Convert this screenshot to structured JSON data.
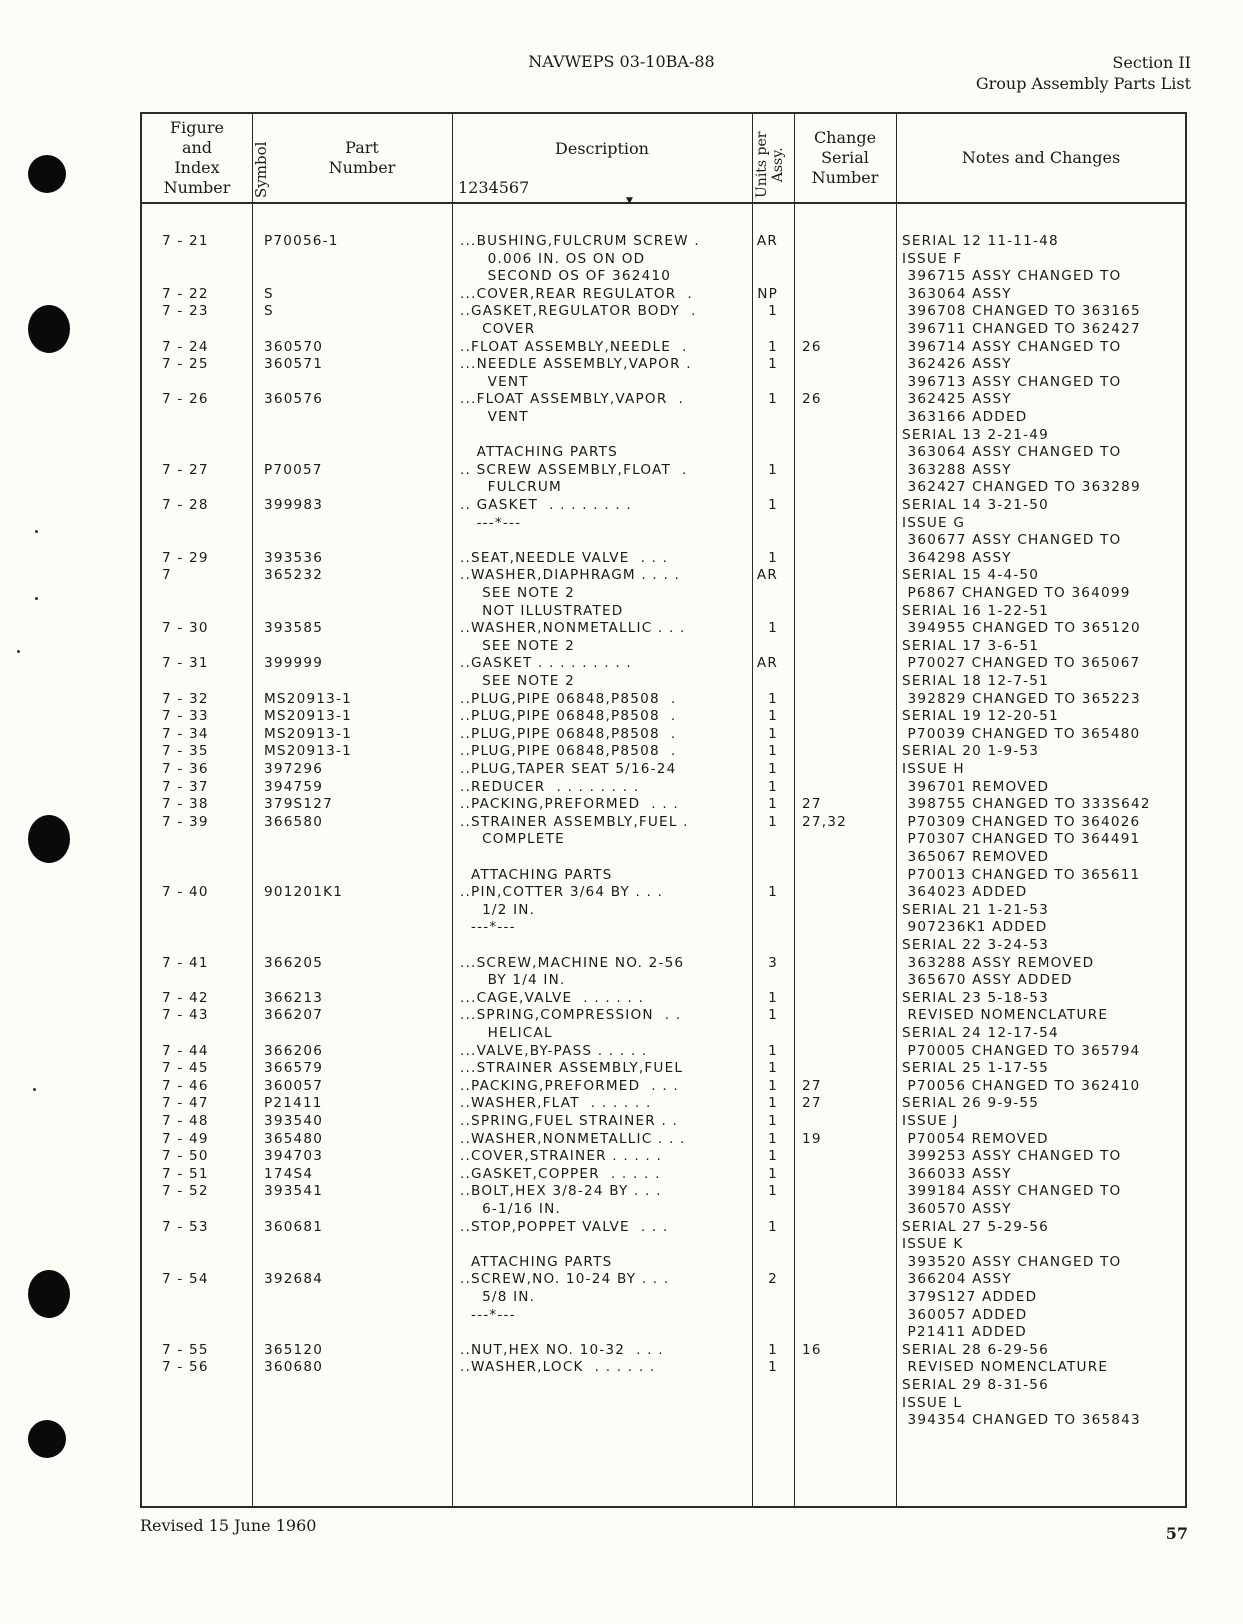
{
  "header": {
    "doc_id": "NAVWEPS 03-10BA-88",
    "section": "Section II",
    "section_title": "Group Assembly Parts List"
  },
  "table": {
    "columns": {
      "index": "Figure and Index Number",
      "index_lines": [
        "Figure",
        "and",
        "Index",
        "Number"
      ],
      "symbol": "Symbol",
      "part": "Part Number",
      "part_lines": [
        "Part",
        "Number"
      ],
      "description": "Description",
      "desc_sub": "1234567",
      "units": "Units per Assy.",
      "units_lines": [
        "Units per",
        "Assy."
      ],
      "change": "Change Serial Number",
      "change_lines": [
        "Change",
        "Serial",
        "Number"
      ],
      "notes": "Notes and Changes"
    },
    "rows": [
      {
        "i": "7 - 21",
        "p": "P70056-1",
        "d": "...BUSHING,FULCRUM SCREW .",
        "q": "AR",
        "c": ""
      },
      {
        "i": "",
        "p": "",
        "d": "     0.006 IN. OS ON OD",
        "q": "",
        "c": ""
      },
      {
        "i": "",
        "p": "",
        "d": "     SECOND OS OF 362410",
        "q": "",
        "c": ""
      },
      {
        "i": "7 - 22",
        "p": "S",
        "d": "...COVER,REAR REGULATOR  .",
        "q": "NP",
        "c": ""
      },
      {
        "i": "7 - 23",
        "p": "S",
        "d": "..GASKET,REGULATOR BODY  .",
        "q": "1",
        "c": ""
      },
      {
        "i": "",
        "p": "",
        "d": "    COVER",
        "q": "",
        "c": ""
      },
      {
        "i": "7 - 24",
        "p": "360570",
        "d": "..FLOAT ASSEMBLY,NEEDLE  .",
        "q": "1",
        "c": "26"
      },
      {
        "i": "7 - 25",
        "p": "360571",
        "d": "...NEEDLE ASSEMBLY,VAPOR .",
        "q": "1",
        "c": ""
      },
      {
        "i": "",
        "p": "",
        "d": "     VENT",
        "q": "",
        "c": ""
      },
      {
        "i": "7 - 26",
        "p": "360576",
        "d": "...FLOAT ASSEMBLY,VAPOR  .",
        "q": "1",
        "c": "26"
      },
      {
        "i": "",
        "p": "",
        "d": "     VENT",
        "q": "",
        "c": ""
      },
      {
        "i": "",
        "p": "",
        "d": "",
        "q": "",
        "c": ""
      },
      {
        "i": "",
        "p": "",
        "d": "   ATTACHING PARTS",
        "q": "",
        "c": ""
      },
      {
        "i": "7 - 27",
        "p": "P70057",
        "d": ".. SCREW ASSEMBLY,FLOAT  .",
        "q": "1",
        "c": ""
      },
      {
        "i": "",
        "p": "",
        "d": "     FULCRUM",
        "q": "",
        "c": ""
      },
      {
        "i": "7 - 28",
        "p": "399983",
        "d": ".. GASKET  . . . . . . . .",
        "q": "1",
        "c": ""
      },
      {
        "i": "",
        "p": "",
        "d": "   ---*---",
        "q": "",
        "c": ""
      },
      {
        "i": "",
        "p": "",
        "d": "",
        "q": "",
        "c": ""
      },
      {
        "i": "7 - 29",
        "p": "393536",
        "d": "..SEAT,NEEDLE VALVE  . . .",
        "q": "1",
        "c": ""
      },
      {
        "i": "7",
        "p": "365232",
        "d": "..WASHER,DIAPHRAGM . . . .",
        "q": "AR",
        "c": ""
      },
      {
        "i": "",
        "p": "",
        "d": "    SEE NOTE 2",
        "q": "",
        "c": ""
      },
      {
        "i": "",
        "p": "",
        "d": "    NOT ILLUSTRATED",
        "q": "",
        "c": ""
      },
      {
        "i": "7 - 30",
        "p": "393585",
        "d": "..WASHER,NONMETALLIC . . .",
        "q": "1",
        "c": ""
      },
      {
        "i": "",
        "p": "",
        "d": "    SEE NOTE 2",
        "q": "",
        "c": ""
      },
      {
        "i": "7 - 31",
        "p": "399999",
        "d": "..GASKET . . . . . . . . .",
        "q": "AR",
        "c": ""
      },
      {
        "i": "",
        "p": "",
        "d": "    SEE NOTE 2",
        "q": "",
        "c": ""
      },
      {
        "i": "7 - 32",
        "p": "MS20913-1",
        "d": "..PLUG,PIPE 06848,P8508  .",
        "q": "1",
        "c": ""
      },
      {
        "i": "7 - 33",
        "p": "MS20913-1",
        "d": "..PLUG,PIPE 06848,P8508  .",
        "q": "1",
        "c": ""
      },
      {
        "i": "7 - 34",
        "p": "MS20913-1",
        "d": "..PLUG,PIPE 06848,P8508  .",
        "q": "1",
        "c": ""
      },
      {
        "i": "7 - 35",
        "p": "MS20913-1",
        "d": "..PLUG,PIPE 06848,P8508  .",
        "q": "1",
        "c": ""
      },
      {
        "i": "7 - 36",
        "p": "397296",
        "d": "..PLUG,TAPER SEAT 5/16-24",
        "q": "1",
        "c": ""
      },
      {
        "i": "7 - 37",
        "p": "394759",
        "d": "..REDUCER  . . . . . . . .",
        "q": "1",
        "c": ""
      },
      {
        "i": "7 - 38",
        "p": "379S127",
        "d": "..PACKING,PREFORMED  . . .",
        "q": "1",
        "c": "27"
      },
      {
        "i": "7 - 39",
        "p": "366580",
        "d": "..STRAINER ASSEMBLY,FUEL .",
        "q": "1",
        "c": "27,32"
      },
      {
        "i": "",
        "p": "",
        "d": "    COMPLETE",
        "q": "",
        "c": ""
      },
      {
        "i": "",
        "p": "",
        "d": "",
        "q": "",
        "c": ""
      },
      {
        "i": "",
        "p": "",
        "d": "  ATTACHING PARTS",
        "q": "",
        "c": ""
      },
      {
        "i": "7 - 40",
        "p": "901201K1",
        "d": "..PIN,COTTER 3/64 BY . . .",
        "q": "1",
        "c": ""
      },
      {
        "i": "",
        "p": "",
        "d": "    1/2 IN.",
        "q": "",
        "c": ""
      },
      {
        "i": "",
        "p": "",
        "d": "  ---*---",
        "q": "",
        "c": ""
      },
      {
        "i": "",
        "p": "",
        "d": "",
        "q": "",
        "c": ""
      },
      {
        "i": "7 - 41",
        "p": "366205",
        "d": "...SCREW,MACHINE NO. 2-56",
        "q": "3",
        "c": ""
      },
      {
        "i": "",
        "p": "",
        "d": "     BY 1/4 IN.",
        "q": "",
        "c": ""
      },
      {
        "i": "7 - 42",
        "p": "366213",
        "d": "...CAGE,VALVE  . . . . . .",
        "q": "1",
        "c": ""
      },
      {
        "i": "7 - 43",
        "p": "366207",
        "d": "...SPRING,COMPRESSION  . .",
        "q": "1",
        "c": ""
      },
      {
        "i": "",
        "p": "",
        "d": "     HELICAL",
        "q": "",
        "c": ""
      },
      {
        "i": "7 - 44",
        "p": "366206",
        "d": "...VALVE,BY-PASS . . . . .",
        "q": "1",
        "c": ""
      },
      {
        "i": "7 - 45",
        "p": "366579",
        "d": "...STRAINER ASSEMBLY,FUEL",
        "q": "1",
        "c": ""
      },
      {
        "i": "7 - 46",
        "p": "360057",
        "d": "..PACKING,PREFORMED  . . .",
        "q": "1",
        "c": "27"
      },
      {
        "i": "7 - 47",
        "p": "P21411",
        "d": "..WASHER,FLAT  . . . . . .",
        "q": "1",
        "c": "27"
      },
      {
        "i": "7 - 48",
        "p": "393540",
        "d": "..SPRING,FUEL STRAINER . .",
        "q": "1",
        "c": ""
      },
      {
        "i": "7 - 49",
        "p": "365480",
        "d": "..WASHER,NONMETALLIC . . .",
        "q": "1",
        "c": "19"
      },
      {
        "i": "7 - 50",
        "p": "394703",
        "d": "..COVER,STRAINER . . . . .",
        "q": "1",
        "c": ""
      },
      {
        "i": "7 - 51",
        "p": "174S4",
        "d": "..GASKET,COPPER  . . . . .",
        "q": "1",
        "c": ""
      },
      {
        "i": "7 - 52",
        "p": "393541",
        "d": "..BOLT,HEX 3/8-24 BY . . .",
        "q": "1",
        "c": ""
      },
      {
        "i": "",
        "p": "",
        "d": "    6-1/16 IN.",
        "q": "",
        "c": ""
      },
      {
        "i": "7 - 53",
        "p": "360681",
        "d": "..STOP,POPPET VALVE  . . .",
        "q": "1",
        "c": ""
      },
      {
        "i": "",
        "p": "",
        "d": "",
        "q": "",
        "c": ""
      },
      {
        "i": "",
        "p": "",
        "d": "  ATTACHING PARTS",
        "q": "",
        "c": ""
      },
      {
        "i": "7 - 54",
        "p": "392684",
        "d": "..SCREW,NO. 10-24 BY . . .",
        "q": "2",
        "c": ""
      },
      {
        "i": "",
        "p": "",
        "d": "    5/8 IN.",
        "q": "",
        "c": ""
      },
      {
        "i": "",
        "p": "",
        "d": "  ---*---",
        "q": "",
        "c": ""
      },
      {
        "i": "",
        "p": "",
        "d": "",
        "q": "",
        "c": ""
      },
      {
        "i": "7 - 55",
        "p": "365120",
        "d": "..NUT,HEX NO. 10-32  . . .",
        "q": "1",
        "c": "16"
      },
      {
        "i": "7 - 56",
        "p": "360680",
        "d": "..WASHER,LOCK  . . . . . .",
        "q": "1",
        "c": ""
      }
    ],
    "notes": [
      "SERIAL 12 11-11-48",
      "ISSUE F",
      " 396715 ASSY CHANGED TO",
      " 363064 ASSY",
      " 396708 CHANGED TO 363165",
      " 396711 CHANGED TO 362427",
      " 396714 ASSY CHANGED TO",
      " 362426 ASSY",
      " 396713 ASSY CHANGED TO",
      " 362425 ASSY",
      " 363166 ADDED",
      "SERIAL 13 2-21-49",
      " 363064 ASSY CHANGED TO",
      " 363288 ASSY",
      " 362427 CHANGED TO 363289",
      "SERIAL 14 3-21-50",
      "ISSUE G",
      " 360677 ASSY CHANGED TO",
      " 364298 ASSY",
      "SERIAL 15 4-4-50",
      " P6867 CHANGED TO 364099",
      "SERIAL 16 1-22-51",
      " 394955 CHANGED TO 365120",
      "SERIAL 17 3-6-51",
      " P70027 CHANGED TO 365067",
      "SERIAL 18 12-7-51",
      " 392829 CHANGED TO 365223",
      "SERIAL 19 12-20-51",
      " P70039 CHANGED TO 365480",
      "SERIAL 20 1-9-53",
      "ISSUE H",
      " 396701 REMOVED",
      " 398755 CHANGED TO 333S642",
      " P70309 CHANGED TO 364026",
      " P70307 CHANGED TO 364491",
      " 365067 REMOVED",
      " P70013 CHANGED TO 365611",
      " 364023 ADDED",
      "SERIAL 21 1-21-53",
      " 907236K1 ADDED",
      "SERIAL 22 3-24-53",
      " 363288 ASSY REMOVED",
      " 365670 ASSY ADDED",
      "SERIAL 23 5-18-53",
      " REVISED NOMENCLATURE",
      "SERIAL 24 12-17-54",
      " P70005 CHANGED TO 365794",
      "SERIAL 25 1-17-55",
      " P70056 CHANGED TO 362410",
      "SERIAL 26 9-9-55",
      "ISSUE J",
      " P70054 REMOVED",
      " 399253 ASSY CHANGED TO",
      " 366033 ASSY",
      " 399184 ASSY CHANGED TO",
      " 360570 ASSY",
      "SERIAL 27 5-29-56",
      "ISSUE K",
      " 393520 ASSY CHANGED TO",
      " 366204 ASSY",
      " 379S127 ADDED",
      " 360057 ADDED",
      " P21411 ADDED",
      "SERIAL 28 6-29-56",
      " REVISED NOMENCLATURE",
      "SERIAL 29 8-31-56",
      "ISSUE L",
      " 394354 CHANGED TO 365843"
    ]
  },
  "footer": {
    "revised": "Revised 15 June 1960",
    "page": "57"
  }
}
